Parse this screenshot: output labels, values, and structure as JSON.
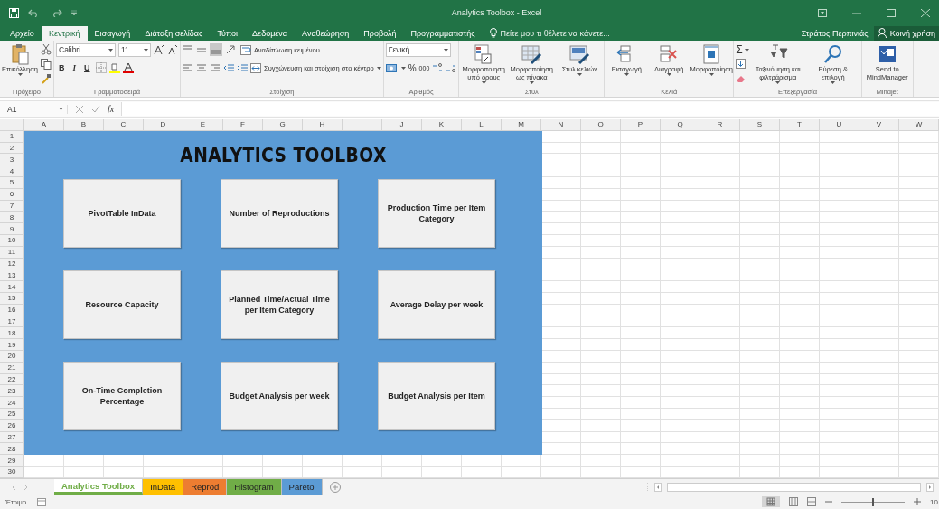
{
  "window": {
    "title": "Analytics Toolbox - Excel"
  },
  "ribbon_tabs": [
    {
      "label": "Αρχείο",
      "selected": false
    },
    {
      "label": "Κεντρική",
      "selected": true
    },
    {
      "label": "Εισαγωγή",
      "selected": false
    },
    {
      "label": "Διάταξη σελίδας",
      "selected": false
    },
    {
      "label": "Τύποι",
      "selected": false
    },
    {
      "label": "Δεδομένα",
      "selected": false
    },
    {
      "label": "Αναθεώρηση",
      "selected": false
    },
    {
      "label": "Προβολή",
      "selected": false
    },
    {
      "label": "Προγραμματιστής",
      "selected": false
    }
  ],
  "tell_me": {
    "placeholder": "Πείτε μου τι θέλετε να κάνετε..."
  },
  "user": "Στράτος Περπινιάς",
  "share": "Κοινή χρήση",
  "ribbon_groups": [
    {
      "kind": "clipboard",
      "name": "Πρόχειρο",
      "paste": "Επικόλληση"
    },
    {
      "kind": "font",
      "name": "Γραμματοσειρά",
      "font": "Calibri",
      "size": "11",
      "styles": [
        "B",
        "I",
        "U"
      ]
    },
    {
      "kind": "alignment",
      "name": "Στοίχιση",
      "wrap": "Αναδίπλωση κειμένου",
      "merge": "Συγχώνευση και στοίχιση στο κέντρο"
    },
    {
      "kind": "number",
      "name": "Αριθμός",
      "format": "Γενική",
      "percent": "%",
      "thousands": "000"
    },
    {
      "kind": "styles",
      "name": "Στυλ",
      "buttons": [
        {
          "label": "Μορφοποίηση υπό όρους",
          "menu": true
        },
        {
          "label": "Μορφοποίηση ως πίνακα",
          "menu": true
        },
        {
          "label": "Στυλ κελιών",
          "menu": true
        }
      ]
    },
    {
      "kind": "cells",
      "name": "Κελιά",
      "buttons": [
        {
          "label": "Εισαγωγή",
          "menu": true
        },
        {
          "label": "Διαγραφή",
          "menu": true
        },
        {
          "label": "Μορφοποίηση",
          "menu": true
        }
      ]
    },
    {
      "kind": "editing",
      "name": "Επεξεργασία",
      "sum": "Σ",
      "buttons": [
        {
          "label": "Ταξινόμηση και φιλτράρισμα",
          "menu": true
        },
        {
          "label": "Εύρεση & επιλογή",
          "menu": true
        }
      ]
    },
    {
      "kind": "addin",
      "name": "Mindjet",
      "buttons": [
        {
          "label": "Send to MindManager",
          "menu": false
        }
      ]
    }
  ],
  "formula_bar": {
    "name_box": "A1",
    "fx": "fx"
  },
  "columns": [
    "A",
    "B",
    "C",
    "D",
    "E",
    "F",
    "G",
    "H",
    "I",
    "J",
    "K",
    "L",
    "M",
    "N",
    "O",
    "P",
    "Q",
    "R",
    "S",
    "T",
    "U",
    "V",
    "W"
  ],
  "rows": [
    "1",
    "2",
    "3",
    "4",
    "5",
    "6",
    "7",
    "8",
    "9",
    "10",
    "11",
    "12",
    "13",
    "14",
    "15",
    "16",
    "17",
    "18",
    "19",
    "20",
    "21",
    "22",
    "23",
    "24",
    "25",
    "26",
    "27",
    "28",
    "29",
    "30"
  ],
  "dashboard": {
    "title": "ANALYTICS TOOLBOX",
    "buttons": [
      "PivotTable InData",
      "Number of Reproductions",
      "Production Time per Item Category",
      "Resource Capacity",
      "Planned Time/Actual Time per Item Category",
      "Average Delay per week",
      "On-Time Completion Percentage",
      "Budget Analysis per week",
      "Budget Analysis per Item"
    ]
  },
  "sheets": [
    {
      "label": "Analytics Toolbox",
      "color": "#70ad47",
      "selected": true
    },
    {
      "label": "InData",
      "color": "#ffc000",
      "selected": false
    },
    {
      "label": "Reprod",
      "color": "#ed7d31",
      "selected": false
    },
    {
      "label": "Histogram",
      "color": "#70ad47",
      "selected": false
    },
    {
      "label": "Pareto",
      "color": "#5b9bd5",
      "selected": false
    }
  ],
  "status_bar": {
    "status": "Έτοιμο",
    "zoom": {
      "level": 0.5,
      "reading": "10"
    }
  }
}
